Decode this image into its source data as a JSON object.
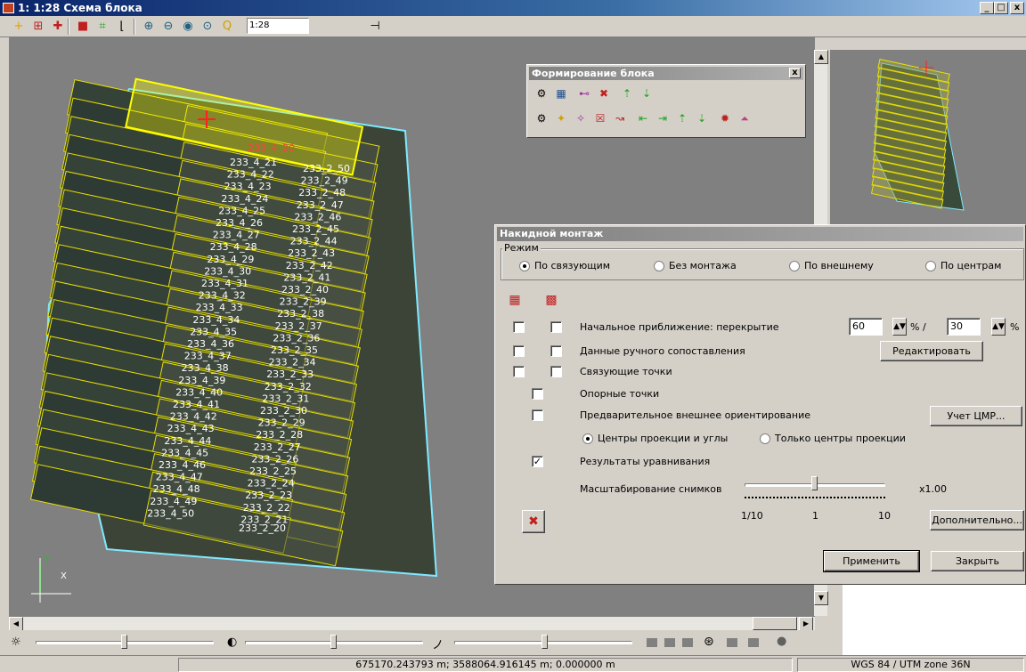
{
  "window": {
    "title": "1: 1:28 Схема блока",
    "min_label": "_",
    "max_label": "□",
    "close_label": "x"
  },
  "toolbar": {
    "scale_value": "1:28",
    "icons": [
      "add-point-icon",
      "grid-icon",
      "add-marker-icon",
      "frame-red-icon",
      "frame-green-icon",
      "corner-icon",
      "zoom-in-icon",
      "zoom-out-icon",
      "zoom-extent-icon",
      "zoom-fit-icon",
      "zoom-scale-icon",
      "pin-icon"
    ]
  },
  "map": {
    "highlight_label": "233_4_20",
    "labels": [
      "233_4_21",
      "233_2_50",
      "233_4_22",
      "233_2_49",
      "233_4_23",
      "233_2_48",
      "233_4_24",
      "233_2_47",
      "233_4_25",
      "233_2_46",
      "233_4_26",
      "233_2_45",
      "233_4_27",
      "233_2_44",
      "233_4_28",
      "233_2_43",
      "233_4_29",
      "233_2_42",
      "233_4_30",
      "233_2_41",
      "233_4_31",
      "233_2_40",
      "233_4_32",
      "233_2_39",
      "233_4_33",
      "233_2_38",
      "233_4_34",
      "233_2_37",
      "233_4_35",
      "233_2_36",
      "233_4_36",
      "233_2_35",
      "233_4_37",
      "233_2_34",
      "233_4_38",
      "233_2_33",
      "233_4_39",
      "233_2_32",
      "233_4_40",
      "233_2_31",
      "233_4_41",
      "233_2_30",
      "233_4_42",
      "233_2_29",
      "233_4_43",
      "233_2_28",
      "233_4_44",
      "233_2_27",
      "233_4_45",
      "233_2_26",
      "233_4_46",
      "233_2_25",
      "233_4_47",
      "233_2_24",
      "233_4_48",
      "233_2_23",
      "233_4_49",
      "233_2_22",
      "233_4_50",
      "233_2_21",
      "233_2_20"
    ],
    "axis_x": "X",
    "axis_y": "Y"
  },
  "form_block": {
    "title": "Формирование блока",
    "close_label": "x"
  },
  "dialog": {
    "title": "Накидной монтаж",
    "close_label": "x",
    "mode_group": "Режим",
    "modes": [
      "По связующим",
      "Без монтажа",
      "По внешнему",
      "По центрам"
    ],
    "selected_mode": "По связующим",
    "initial_approx": "Начальное приближение: перекрытие",
    "overlap_1": "60",
    "overlap_sep": "% /",
    "overlap_2": "30",
    "percent": "%",
    "manual_matching": "Данные ручного сопоставления",
    "edit_button": "Редактировать",
    "tie_points": "Связующие точки",
    "control_points": "Опорные точки",
    "pre_orientation": "Предварительное внешнее ориентирование",
    "dem_button": "Учет ЦМР...",
    "proj_centers_angles": "Центры проекции и углы",
    "proj_centers_only": "Только центры проекции",
    "adjust_results": "Результаты уравнивания",
    "adjust_checked": true,
    "scaling_label": "Масштабирование снимков",
    "scale_value": "x1.00",
    "scale_position": 0.5,
    "tick_min": "1/10",
    "tick_mid": "1",
    "tick_max": "10",
    "more_button": "Дополнительно...",
    "apply_button": "Применить",
    "close_button": "Закрыть"
  },
  "status": {
    "coords": "675170.243793 m; 3588064.916145 m; 0.000000 m",
    "crs": "WGS 84 / UTM zone 36N"
  },
  "colors": {
    "titlebar": "#0a246a",
    "map_bg": "#808080",
    "outline": "#7fe8ff",
    "frame": "#e8e000",
    "selected_frame": "#ffff00",
    "marker": "#ff2020"
  }
}
